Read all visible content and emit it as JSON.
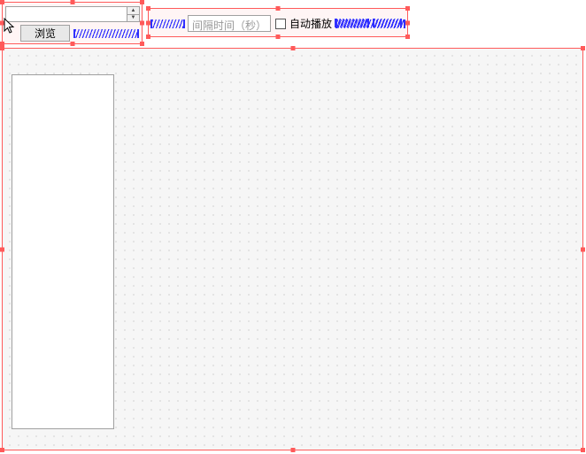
{
  "topbar": {
    "browse_group": {
      "combo_value": "",
      "browse_btn": "浏览"
    },
    "interval_group": {
      "textbox_placeholder": "间隔时间（秒）",
      "autoplay_label": "自动播放"
    }
  }
}
